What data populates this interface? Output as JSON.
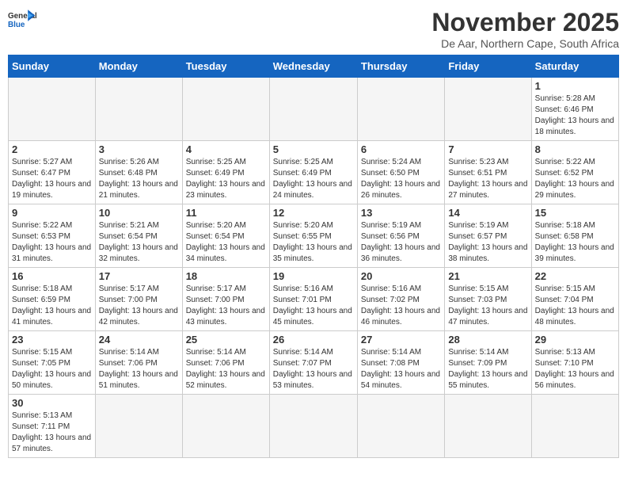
{
  "header": {
    "logo_general": "General",
    "logo_blue": "Blue",
    "month_title": "November 2025",
    "location": "De Aar, Northern Cape, South Africa"
  },
  "days_of_week": [
    "Sunday",
    "Monday",
    "Tuesday",
    "Wednesday",
    "Thursday",
    "Friday",
    "Saturday"
  ],
  "weeks": [
    [
      {
        "day": "",
        "info": ""
      },
      {
        "day": "",
        "info": ""
      },
      {
        "day": "",
        "info": ""
      },
      {
        "day": "",
        "info": ""
      },
      {
        "day": "",
        "info": ""
      },
      {
        "day": "",
        "info": ""
      },
      {
        "day": "1",
        "info": "Sunrise: 5:28 AM\nSunset: 6:46 PM\nDaylight: 13 hours and 18 minutes."
      }
    ],
    [
      {
        "day": "2",
        "info": "Sunrise: 5:27 AM\nSunset: 6:47 PM\nDaylight: 13 hours and 19 minutes."
      },
      {
        "day": "3",
        "info": "Sunrise: 5:26 AM\nSunset: 6:48 PM\nDaylight: 13 hours and 21 minutes."
      },
      {
        "day": "4",
        "info": "Sunrise: 5:25 AM\nSunset: 6:49 PM\nDaylight: 13 hours and 23 minutes."
      },
      {
        "day": "5",
        "info": "Sunrise: 5:25 AM\nSunset: 6:49 PM\nDaylight: 13 hours and 24 minutes."
      },
      {
        "day": "6",
        "info": "Sunrise: 5:24 AM\nSunset: 6:50 PM\nDaylight: 13 hours and 26 minutes."
      },
      {
        "day": "7",
        "info": "Sunrise: 5:23 AM\nSunset: 6:51 PM\nDaylight: 13 hours and 27 minutes."
      },
      {
        "day": "8",
        "info": "Sunrise: 5:22 AM\nSunset: 6:52 PM\nDaylight: 13 hours and 29 minutes."
      }
    ],
    [
      {
        "day": "9",
        "info": "Sunrise: 5:22 AM\nSunset: 6:53 PM\nDaylight: 13 hours and 31 minutes."
      },
      {
        "day": "10",
        "info": "Sunrise: 5:21 AM\nSunset: 6:54 PM\nDaylight: 13 hours and 32 minutes."
      },
      {
        "day": "11",
        "info": "Sunrise: 5:20 AM\nSunset: 6:54 PM\nDaylight: 13 hours and 34 minutes."
      },
      {
        "day": "12",
        "info": "Sunrise: 5:20 AM\nSunset: 6:55 PM\nDaylight: 13 hours and 35 minutes."
      },
      {
        "day": "13",
        "info": "Sunrise: 5:19 AM\nSunset: 6:56 PM\nDaylight: 13 hours and 36 minutes."
      },
      {
        "day": "14",
        "info": "Sunrise: 5:19 AM\nSunset: 6:57 PM\nDaylight: 13 hours and 38 minutes."
      },
      {
        "day": "15",
        "info": "Sunrise: 5:18 AM\nSunset: 6:58 PM\nDaylight: 13 hours and 39 minutes."
      }
    ],
    [
      {
        "day": "16",
        "info": "Sunrise: 5:18 AM\nSunset: 6:59 PM\nDaylight: 13 hours and 41 minutes."
      },
      {
        "day": "17",
        "info": "Sunrise: 5:17 AM\nSunset: 7:00 PM\nDaylight: 13 hours and 42 minutes."
      },
      {
        "day": "18",
        "info": "Sunrise: 5:17 AM\nSunset: 7:00 PM\nDaylight: 13 hours and 43 minutes."
      },
      {
        "day": "19",
        "info": "Sunrise: 5:16 AM\nSunset: 7:01 PM\nDaylight: 13 hours and 45 minutes."
      },
      {
        "day": "20",
        "info": "Sunrise: 5:16 AM\nSunset: 7:02 PM\nDaylight: 13 hours and 46 minutes."
      },
      {
        "day": "21",
        "info": "Sunrise: 5:15 AM\nSunset: 7:03 PM\nDaylight: 13 hours and 47 minutes."
      },
      {
        "day": "22",
        "info": "Sunrise: 5:15 AM\nSunset: 7:04 PM\nDaylight: 13 hours and 48 minutes."
      }
    ],
    [
      {
        "day": "23",
        "info": "Sunrise: 5:15 AM\nSunset: 7:05 PM\nDaylight: 13 hours and 50 minutes."
      },
      {
        "day": "24",
        "info": "Sunrise: 5:14 AM\nSunset: 7:06 PM\nDaylight: 13 hours and 51 minutes."
      },
      {
        "day": "25",
        "info": "Sunrise: 5:14 AM\nSunset: 7:06 PM\nDaylight: 13 hours and 52 minutes."
      },
      {
        "day": "26",
        "info": "Sunrise: 5:14 AM\nSunset: 7:07 PM\nDaylight: 13 hours and 53 minutes."
      },
      {
        "day": "27",
        "info": "Sunrise: 5:14 AM\nSunset: 7:08 PM\nDaylight: 13 hours and 54 minutes."
      },
      {
        "day": "28",
        "info": "Sunrise: 5:14 AM\nSunset: 7:09 PM\nDaylight: 13 hours and 55 minutes."
      },
      {
        "day": "29",
        "info": "Sunrise: 5:13 AM\nSunset: 7:10 PM\nDaylight: 13 hours and 56 minutes."
      }
    ],
    [
      {
        "day": "30",
        "info": "Sunrise: 5:13 AM\nSunset: 7:11 PM\nDaylight: 13 hours and 57 minutes."
      },
      {
        "day": "",
        "info": ""
      },
      {
        "day": "",
        "info": ""
      },
      {
        "day": "",
        "info": ""
      },
      {
        "day": "",
        "info": ""
      },
      {
        "day": "",
        "info": ""
      },
      {
        "day": "",
        "info": ""
      }
    ]
  ]
}
